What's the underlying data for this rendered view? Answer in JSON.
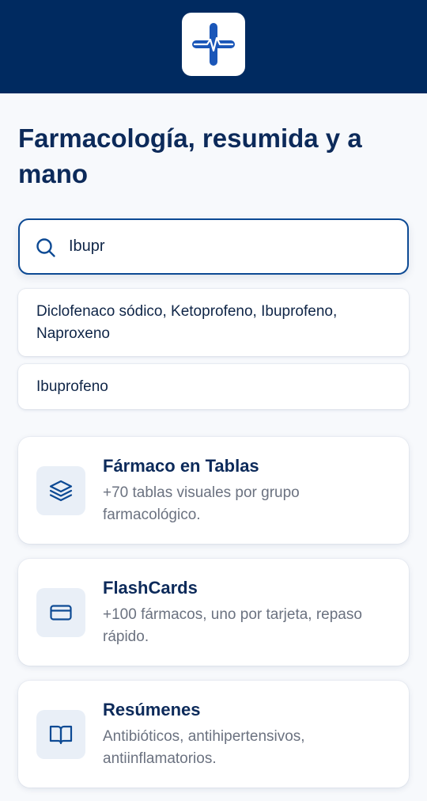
{
  "header": {
    "logo_icon": "medical-cross-pulse-icon",
    "bg_color": "#002a60"
  },
  "headline": "Farmacología, resumida y a mano",
  "search": {
    "icon": "search-icon",
    "value": "Ibupr"
  },
  "suggestions": [
    {
      "text": "Diclofenaco sódico, Ketoprofeno, Ibuprofeno, Naproxeno"
    },
    {
      "text": "Ibuprofeno"
    }
  ],
  "cards": [
    {
      "icon": "layers-icon",
      "title": "Fármaco en Tablas",
      "description": "+70 tablas visuales por grupo farmacológico."
    },
    {
      "icon": "card-icon",
      "title": "FlashCards",
      "description": "+100 fármacos, uno por tarjeta, repaso rápido."
    },
    {
      "icon": "book-icon",
      "title": "Resúmenes",
      "description": "Antibióticos, antihipertensivos, antiinflamatorios."
    }
  ],
  "colors": {
    "accent": "#0d4a94",
    "heading": "#0c2a5a",
    "muted": "#6b7280"
  }
}
